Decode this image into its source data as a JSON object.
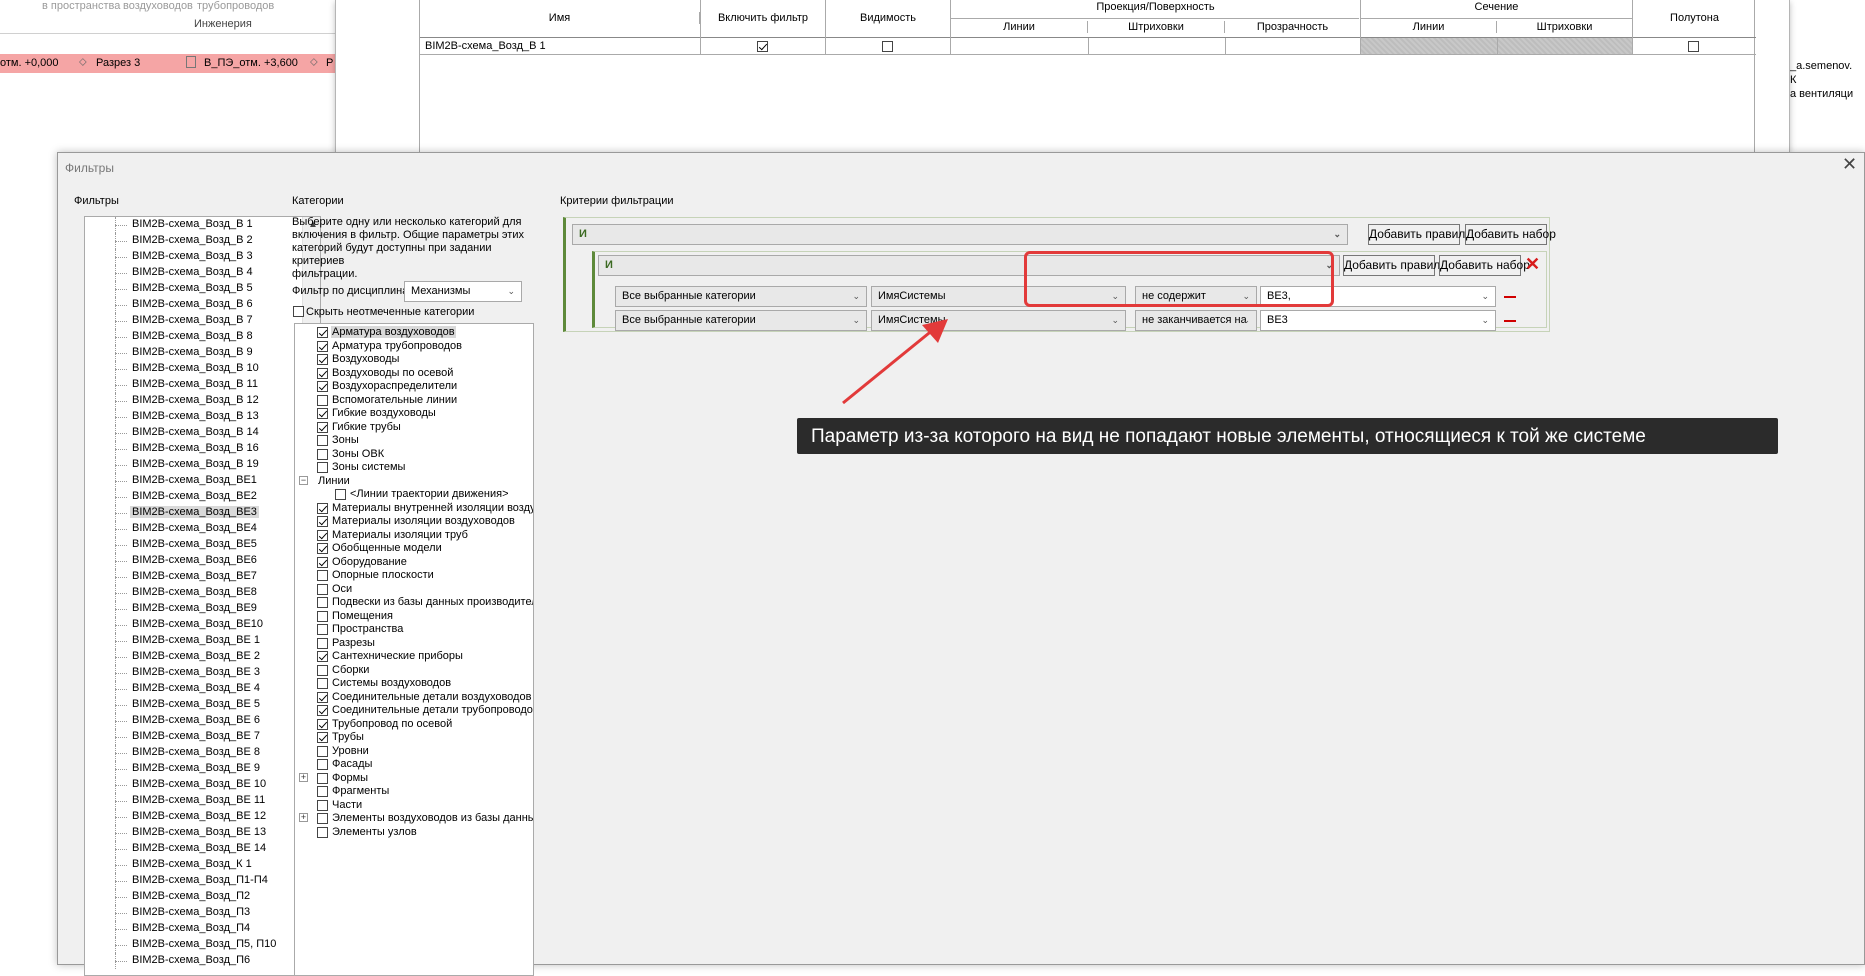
{
  "ribbon": {
    "items": [
      "в пространства",
      "воздуховодов",
      "трубопроводов"
    ],
    "group": "Инженерия"
  },
  "view_tabs": [
    "отм. +0,000",
    "Разрез 3",
    "В_ПЭ_отм. +3,600",
    "Р"
  ],
  "right_side": {
    "user": "_a.semenov.",
    "line2": "К",
    "line3": "а вентиляци"
  },
  "vg_table": {
    "headers": {
      "name": "Имя",
      "enable": "Включить фильтр",
      "visibility": "Видимость",
      "proj": "Проекция/Поверхность",
      "lines": "Линии",
      "hatch": "Штриховки",
      "transparency": "Прозрачность",
      "cut": "Сечение",
      "cut_lines": "Линии",
      "cut_hatch": "Штриховки",
      "halftone": "Полутона"
    },
    "row": {
      "name": "BIM2B-схема_Возд_В 1"
    }
  },
  "dialog": {
    "title": "Фильтры",
    "filters_label": "Фильтры",
    "filters": [
      "BIM2B-схема_Возд_В 1",
      "BIM2B-схема_Возд_В 2",
      "BIM2B-схема_Возд_В 3",
      "BIM2B-схема_Возд_В 4",
      "BIM2B-схема_Возд_В 5",
      "BIM2B-схема_Возд_В 6",
      "BIM2B-схема_Возд_В 7",
      "BIM2B-схема_Возд_В 8",
      "BIM2B-схема_Возд_В 9",
      "BIM2B-схема_Возд_В 10",
      "BIM2B-схема_Возд_В 11",
      "BIM2B-схема_Возд_В 12",
      "BIM2B-схема_Возд_В 13",
      "BIM2B-схема_Возд_В 14",
      "BIM2B-схема_Возд_В 16",
      "BIM2B-схема_Возд_В 19",
      "BIM2B-схема_Возд_ВЕ1",
      "BIM2B-схема_Возд_ВЕ2",
      "BIM2B-схема_Возд_ВЕ3",
      "BIM2B-схема_Возд_ВЕ4",
      "BIM2B-схема_Возд_ВЕ5",
      "BIM2B-схема_Возд_ВЕ6",
      "BIM2B-схема_Возд_ВЕ7",
      "BIM2B-схема_Возд_ВЕ8",
      "BIM2B-схема_Возд_ВЕ9",
      "BIM2B-схема_Возд_ВЕ10",
      "BIM2B-схема_Возд_ВЕ 1",
      "BIM2B-схема_Возд_ВЕ 2",
      "BIM2B-схема_Возд_ВЕ 3",
      "BIM2B-схема_Возд_ВЕ 4",
      "BIM2B-схема_Возд_ВЕ 5",
      "BIM2B-схема_Возд_ВЕ 6",
      "BIM2B-схема_Возд_ВЕ 7",
      "BIM2B-схема_Возд_ВЕ 8",
      "BIM2B-схема_Возд_ВЕ 9",
      "BIM2B-схема_Возд_ВЕ 10",
      "BIM2B-схема_Возд_ВЕ 11",
      "BIM2B-схема_Возд_ВЕ 12",
      "BIM2B-схема_Возд_ВЕ 13",
      "BIM2B-схема_Возд_ВЕ 14",
      "BIM2B-схема_Возд_К 1",
      "BIM2B-схема_Возд_П1-П4",
      "BIM2B-схема_Возд_П2",
      "BIM2B-схема_Возд_П3",
      "BIM2B-схема_Возд_П4",
      "BIM2B-схема_Возд_П5, П10",
      "BIM2B-схема_Возд_П6"
    ],
    "selected_filter_index": 18,
    "categories": {
      "label": "Категории",
      "help": [
        "Выберите одну или несколько категорий для",
        "включения в фильтр. Общие параметры этих",
        "категорий будут доступны при задании критериев",
        "фильтрации."
      ],
      "discipline_label": "Фильтр по дисциплинам:",
      "discipline_value": "Механизмы",
      "hide_unchecked": "Скрыть неотмеченные категории",
      "items": [
        {
          "label": "Арматура воздуховодов",
          "checked": true,
          "sel": true
        },
        {
          "label": "Арматура трубопроводов",
          "checked": true
        },
        {
          "label": "Воздуховоды",
          "checked": true
        },
        {
          "label": "Воздуховоды по осевой",
          "checked": true
        },
        {
          "label": "Воздухораспределители",
          "checked": true
        },
        {
          "label": "Вспомогательные линии",
          "checked": false
        },
        {
          "label": "Гибкие воздуховоды",
          "checked": true
        },
        {
          "label": "Гибкие трубы",
          "checked": true
        },
        {
          "label": "Зоны",
          "checked": false
        },
        {
          "label": "Зоны ОВК",
          "checked": false
        },
        {
          "label": "Зоны системы",
          "checked": false
        },
        {
          "label": "Линии",
          "checked": null,
          "tree": "minus"
        },
        {
          "label": "<Линии траектории движения>",
          "checked": false,
          "indent": true
        },
        {
          "label": "Материалы внутренней изоляции воздухово...",
          "checked": true
        },
        {
          "label": "Материалы изоляции воздуховодов",
          "checked": true
        },
        {
          "label": "Материалы изоляции труб",
          "checked": true
        },
        {
          "label": "Обобщенные модели",
          "checked": true
        },
        {
          "label": "Оборудование",
          "checked": true
        },
        {
          "label": "Опорные плоскости",
          "checked": false
        },
        {
          "label": "Оси",
          "checked": false
        },
        {
          "label": "Подвески из базы данных производителя М...",
          "checked": false
        },
        {
          "label": "Помещения",
          "checked": false
        },
        {
          "label": "Пространства",
          "checked": false
        },
        {
          "label": "Разрезы",
          "checked": false
        },
        {
          "label": "Сантехнические приборы",
          "checked": true
        },
        {
          "label": "Сборки",
          "checked": false
        },
        {
          "label": "Системы воздуховодов",
          "checked": false
        },
        {
          "label": "Соединительные детали воздуховодов",
          "checked": true
        },
        {
          "label": "Соединительные детали трубопроводов",
          "checked": true
        },
        {
          "label": "Трубопровод по осевой",
          "checked": true
        },
        {
          "label": "Трубы",
          "checked": true
        },
        {
          "label": "Уровни",
          "checked": false
        },
        {
          "label": "Фасады",
          "checked": false
        },
        {
          "label": "Формы",
          "checked": false,
          "tree": "plus"
        },
        {
          "label": "Фрагменты",
          "checked": false
        },
        {
          "label": "Части",
          "checked": false
        },
        {
          "label": "Элементы воздуховодов из базы данных произ",
          "checked": false,
          "tree": "plus"
        },
        {
          "label": "Элементы узлов",
          "checked": false
        }
      ]
    },
    "criteria": {
      "label": "Критерии фильтрации",
      "outer_op": "И",
      "inner_op": "И",
      "add_rule": "Добавить правило",
      "add_set": "Добавить набор",
      "rules": [
        {
          "category": "Все выбранные категории",
          "param": "ИмяСистемы",
          "op": "не содержит",
          "value": "ВЕ3,"
        },
        {
          "category": "Все выбранные категории",
          "param": "ИмяСистемы",
          "op": "не заканчивается на",
          "value": "ВЕ3"
        }
      ]
    },
    "annotation": "Параметр из-за которого на вид не попадают новые элементы, относящиеся к той же системе"
  },
  "colors": {
    "accent_red": "#e23a3a",
    "set_border": "#5e8a3a",
    "banner_bg": "#2b2b2b"
  }
}
